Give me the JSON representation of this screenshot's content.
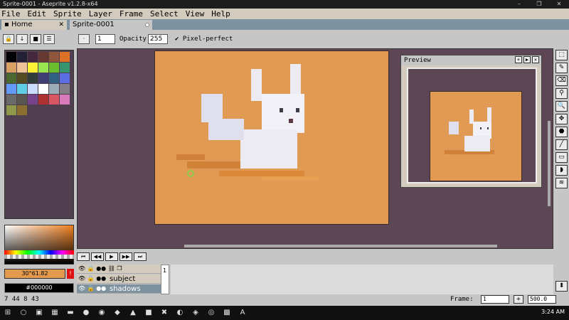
{
  "window": {
    "title": "Sprite-0001 - Aseprite v1.2.8-x64",
    "controls": [
      "–",
      "❐",
      "✕"
    ]
  },
  "menu": [
    "File",
    "Edit",
    "Sprite",
    "Layer",
    "Frame",
    "Select",
    "View",
    "Help"
  ],
  "tabs": {
    "home": "Home",
    "sprite": "Sprite-0001"
  },
  "toolbar": {
    "opacity_label": "Opacity:",
    "opacity_value": "255",
    "pixel_perfect_label": "Pixel-perfect",
    "brush_value": "1"
  },
  "palette": {
    "colors": [
      "#000000",
      "#222034",
      "#45283c",
      "#663931",
      "#8f563b",
      "#df7126",
      "#d9a066",
      "#eec39a",
      "#fbf236",
      "#99e550",
      "#6abe30",
      "#37946e",
      "#4b692f",
      "#524b24",
      "#323c39",
      "#3f3f74",
      "#306082",
      "#5b6ee1",
      "#639bff",
      "#5fcde4",
      "#cbdbfc",
      "#ffffff",
      "#9badb7",
      "#847e87",
      "#696a6a",
      "#595652",
      "#76428a",
      "#ac3232",
      "#d95763",
      "#d77bba",
      "#8f974a",
      "#8a6f30"
    ]
  },
  "color_bar": {
    "fg_value": "30°61.82",
    "bg_value": "#000000"
  },
  "preview": {
    "title": "Preview"
  },
  "timeline": {
    "layers": [
      {
        "name": "",
        "icons": "👁 🔒 ●● ⛓ ❐"
      },
      {
        "name": "subject",
        "icons": "👁 🔒 ●●"
      },
      {
        "name": "shadows",
        "icons": "👁 🔒 ●●"
      }
    ],
    "frame_number": "1"
  },
  "status": {
    "coords": "7  44  8  43",
    "frame_label": "Frame:",
    "frame_value": "1",
    "zoom_value": "500.0"
  },
  "taskbar": {
    "time": "3:24 AM"
  }
}
